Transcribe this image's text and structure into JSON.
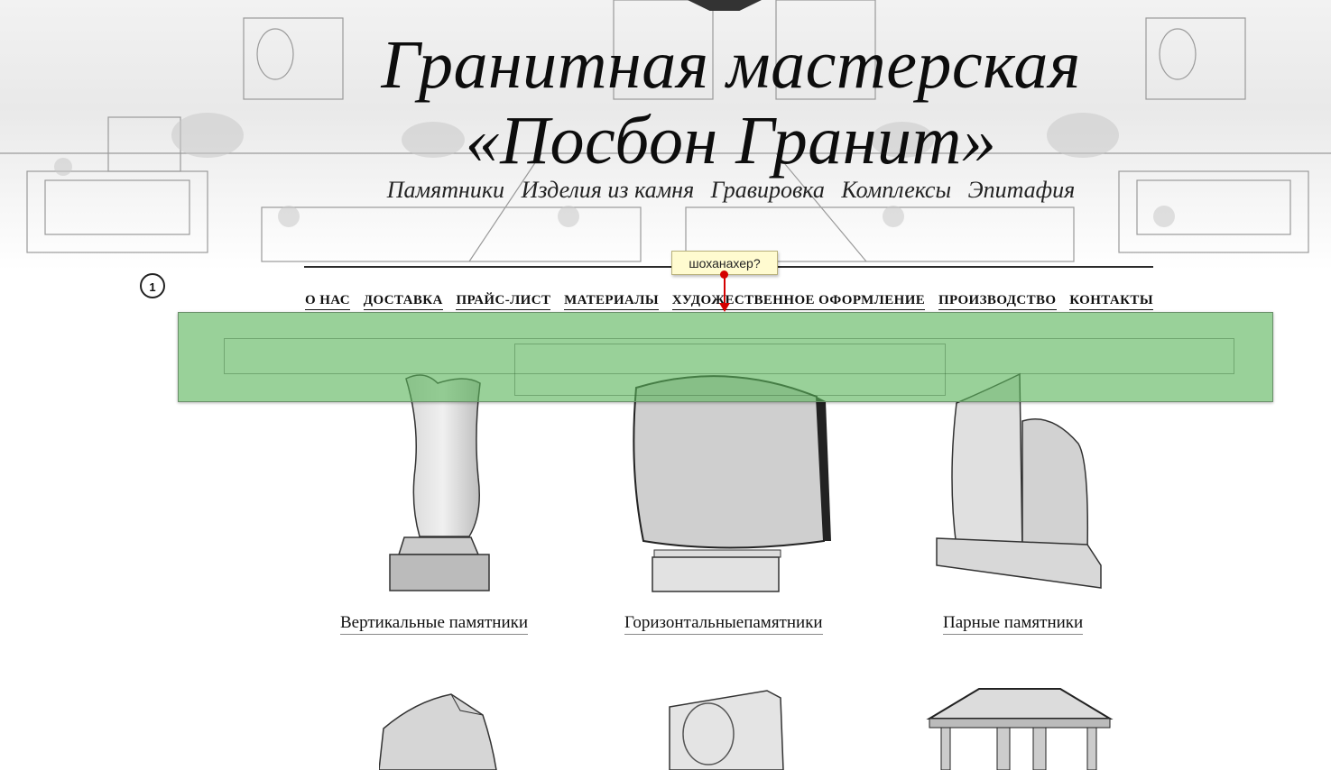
{
  "header": {
    "title_line1": "Гранитная мастерская",
    "title_line2": "«Посбон Гранит»",
    "tagline": [
      "Памятники",
      "Изделия из камня",
      "Гравировка",
      "Комплексы",
      "Эпитафия"
    ]
  },
  "nav": {
    "items": [
      "О НАС",
      "ДОСТАВКА",
      "ПРАЙС-ЛИСТ",
      "МАТЕРИАЛЫ",
      "ХУДОЖЕСТВЕННОЕ ОФОРМЛЕНИЕ",
      "ПРОИЗВОДСТВО",
      "КОНТАКТЫ"
    ]
  },
  "annotation": {
    "badge": "1",
    "tooltip": "шоханахер?",
    "marker_color": "#d40000",
    "overlay_color": "#5ab45a"
  },
  "catalog": {
    "items": [
      {
        "label": "Вертикальные памятники",
        "icon": "vertical-monument-icon"
      },
      {
        "label": "Горизонтальныепамятники",
        "icon": "horizontal-monument-icon"
      },
      {
        "label": "Парные памятники",
        "icon": "double-monument-icon"
      }
    ],
    "second_row_icons": [
      "rock-monument-icon",
      "portrait-monument-icon",
      "gazebo-complex-icon"
    ]
  }
}
